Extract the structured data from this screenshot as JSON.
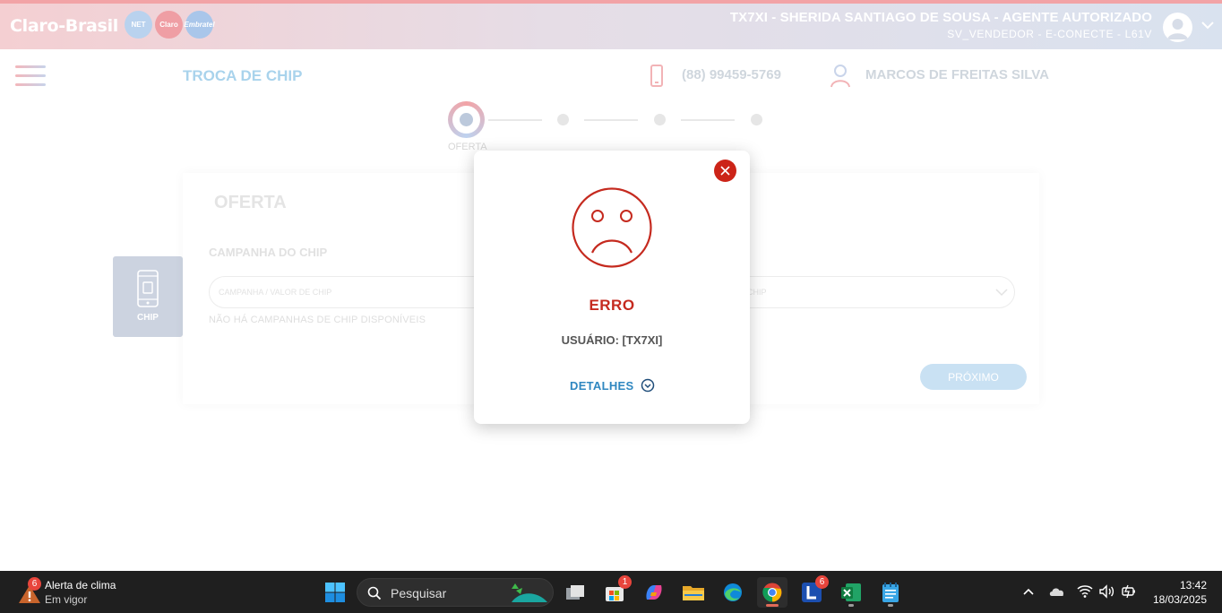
{
  "header": {
    "logo_text": "Claro-Brasil",
    "brand_badges": [
      "NET",
      "Claro",
      "Embratel"
    ],
    "user_name": "TX7XI - SHERIDA SANTIAGO DE SOUSA - AGENTE AUTORIZADO",
    "user_role": "SV_VENDEDOR - E-CONECTE - L61V"
  },
  "subheader": {
    "page_title": "TROCA DE CHIP",
    "phone": "(88) 99459-5769",
    "client_name": "MARCOS DE FREITAS SILVA"
  },
  "stepper": {
    "active_label": "OFERTA"
  },
  "side_tab": {
    "label": "CHIP"
  },
  "card": {
    "title": "OFERTA",
    "field_label": "CAMPANHA DO CHIP",
    "select_placeholder": "CAMPANHA / VALOR DE CHIP",
    "select_placeholder_tail": "CHIP",
    "helper_text": "NÃO HÁ CAMPANHAS DE CHIP DISPONÍVEIS",
    "next_label": "PRÓXIMO"
  },
  "modal": {
    "title": "ERRO",
    "message": "USUÁRIO: [TX7XI]",
    "details_label": "DETALHES"
  },
  "taskbar": {
    "weather_badge": "6",
    "weather_title": "Alerta de clima",
    "weather_sub": "Em vigor",
    "search_placeholder": "Pesquisar",
    "store_badge": "1",
    "launcher_badge": "6",
    "time": "13:42",
    "date": "18/03/2025"
  },
  "colors": {
    "error_red": "#c52a1f",
    "close_red": "#cc2418",
    "details_blue": "#2f87c0",
    "taskbar_bg": "#1f1f1f"
  }
}
